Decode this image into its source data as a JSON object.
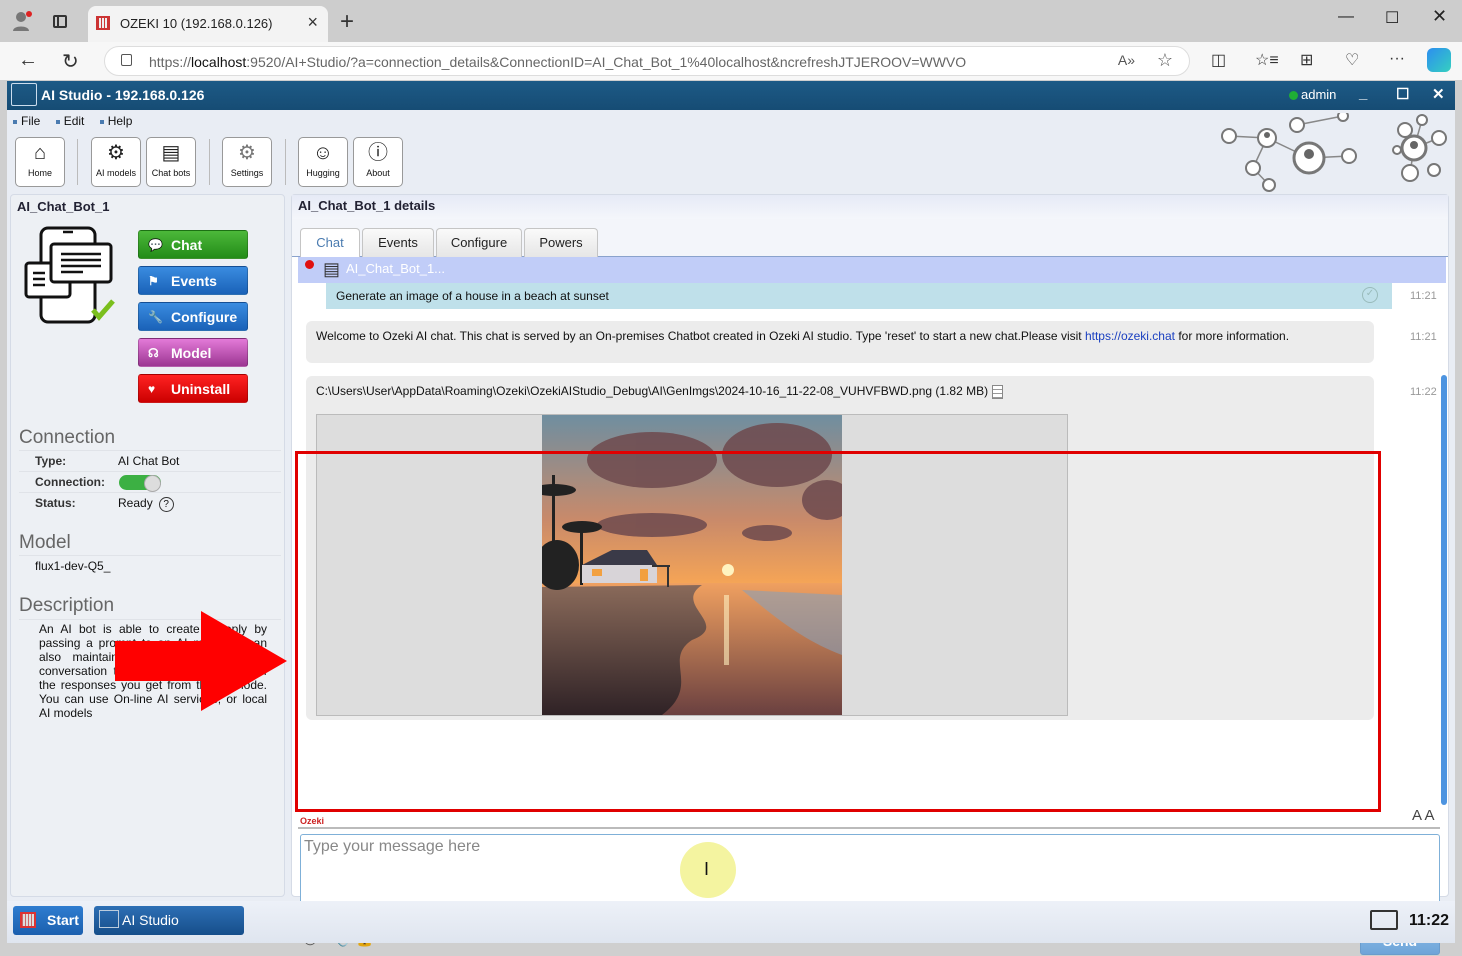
{
  "browser": {
    "tab_title": "OZEKI 10 (192.168.0.126)",
    "url_host": "localhost",
    "url_prefix": "https://",
    "url_rest": ":9520/AI+Studio/?a=connection_details&ConnectionID=AI_Chat_Bot_1%40localhost&ncrefreshJTJEROOV=WWVO"
  },
  "app": {
    "title": "AI Studio - 192.168.0.126",
    "user": "admin",
    "menu": [
      "File",
      "Edit",
      "Help"
    ],
    "toolbar": [
      {
        "label": "Home",
        "icon": "home-icon"
      },
      {
        "label": "AI models",
        "icon": "ai-models-icon"
      },
      {
        "label": "Chat bots",
        "icon": "chat-bots-icon"
      },
      {
        "label": "Settings",
        "icon": "gear-icon"
      },
      {
        "label": "Hugging",
        "icon": "hugging-face-icon"
      },
      {
        "label": "About",
        "icon": "info-icon"
      }
    ]
  },
  "left": {
    "title": "AI_Chat_Bot_1",
    "actions": [
      {
        "label": "Chat",
        "color": "#2e9a1c"
      },
      {
        "label": "Events",
        "color": "#1f6fc8"
      },
      {
        "label": "Configure",
        "color": "#1f6fc8"
      },
      {
        "label": "Model",
        "color": "#b048a8"
      },
      {
        "label": "Uninstall",
        "color": "#d91414"
      }
    ],
    "connection_heading": "Connection",
    "connection": {
      "type_label": "Type:",
      "type_value": "AI Chat Bot",
      "conn_label": "Connection:",
      "conn_on": true,
      "status_label": "Status:",
      "status_value": "Ready"
    },
    "model_heading": "Model",
    "model_value": "flux1-dev-Q5_",
    "description_heading": "Description",
    "description": "An AI bot is able to create a reply by passing a prompt to an AI model. It can also maintain a chat history of the conversation to improve the accuracy of the responses you get from the AI mode. You can use On-line AI services, or local AI models"
  },
  "main": {
    "title": "AI_Chat_Bot_1 details",
    "tabs": [
      "Chat",
      "Events",
      "Configure",
      "Powers"
    ],
    "active_tab": "Chat",
    "chat_header": "AI_Chat_Bot_1...",
    "messages": [
      {
        "dir": "out",
        "text": "Generate an image of a house in a beach at sunset",
        "time": "11:21"
      },
      {
        "dir": "in",
        "text": "Welcome to Ozeki AI chat. This chat is served by an On-premises Chatbot created in Ozeki AI studio. Type 'reset' to start a new chat.Please visit ",
        "link": "https://ozeki.chat",
        "text_after": " for more information.",
        "time": "11:21"
      },
      {
        "dir": "in",
        "text": "C:\\Users\\User\\AppData\\Roaming\\Ozeki\\OzekiAIStudio_Debug\\AI\\GenImgs\\2024-10-16_11-22-08_VUHVFBWD.png (1.82 MB)",
        "time": "11:22"
      }
    ],
    "sender_label": "Ozeki",
    "font_size_toggle": "A A",
    "input_placeholder": "Type your message here",
    "send_label": "Send"
  },
  "taskbar": {
    "start_label": "Start",
    "app_label": "AI Studio",
    "clock": "11:22"
  }
}
